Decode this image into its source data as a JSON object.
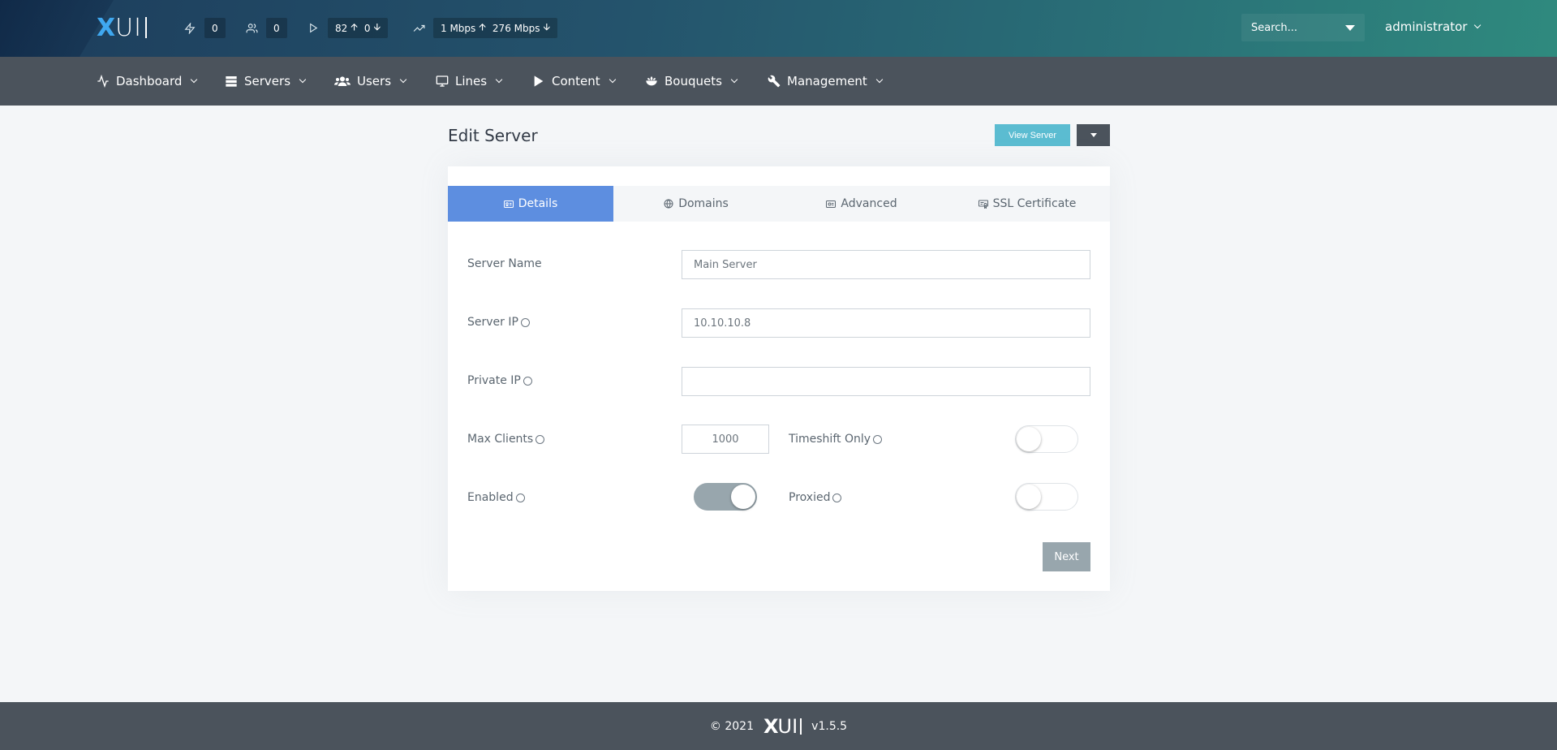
{
  "brand": {
    "logo_x": "X",
    "logo_ui": "UI"
  },
  "topbar": {
    "stats": [
      {
        "icon": "bolt-icon",
        "value": "0"
      },
      {
        "icon": "users-icon",
        "value": "0"
      },
      {
        "icon": "play-icon",
        "value_up": "82",
        "value_down": "0"
      },
      {
        "icon": "trend-icon",
        "value_up": "1 Mbps",
        "value_down": "276 Mbps"
      }
    ],
    "search_placeholder": "Search...",
    "user": "administrator"
  },
  "nav": {
    "items": [
      {
        "label": "Dashboard",
        "icon": "activity-icon"
      },
      {
        "label": "Servers",
        "icon": "server-icon"
      },
      {
        "label": "Users",
        "icon": "users-icon"
      },
      {
        "label": "Lines",
        "icon": "monitor-icon"
      },
      {
        "label": "Content",
        "icon": "play-icon"
      },
      {
        "label": "Bouquets",
        "icon": "bouquet-icon"
      },
      {
        "label": "Management",
        "icon": "wrench-icon"
      }
    ]
  },
  "page": {
    "title": "Edit Server",
    "view_button": "View Server",
    "tabs": [
      {
        "label": "Details",
        "icon": "id-card-icon",
        "active": true
      },
      {
        "label": "Domains",
        "icon": "globe-icon",
        "active": false
      },
      {
        "label": "Advanced",
        "icon": "sliders-icon",
        "active": false
      },
      {
        "label": "SSL Certificate",
        "icon": "certificate-icon",
        "active": false
      }
    ],
    "form": {
      "server_name_label": "Server Name",
      "server_name_value": "Main Server",
      "server_ip_label": "Server IP",
      "server_ip_value": "10.10.10.8",
      "private_ip_label": "Private IP",
      "private_ip_value": "",
      "max_clients_label": "Max Clients",
      "max_clients_value": "1000",
      "timeshift_label": "Timeshift Only",
      "timeshift_on": false,
      "enabled_label": "Enabled",
      "enabled_on": true,
      "proxied_label": "Proxied",
      "proxied_on": false
    },
    "next_button": "Next"
  },
  "footer": {
    "copyright": "© 2021",
    "version": "v1.5.5"
  },
  "colors": {
    "accent": "#5d8ee0",
    "info": "#5bbcd1",
    "nav": "#4b535c",
    "toggle_on": "#98a6ad"
  }
}
